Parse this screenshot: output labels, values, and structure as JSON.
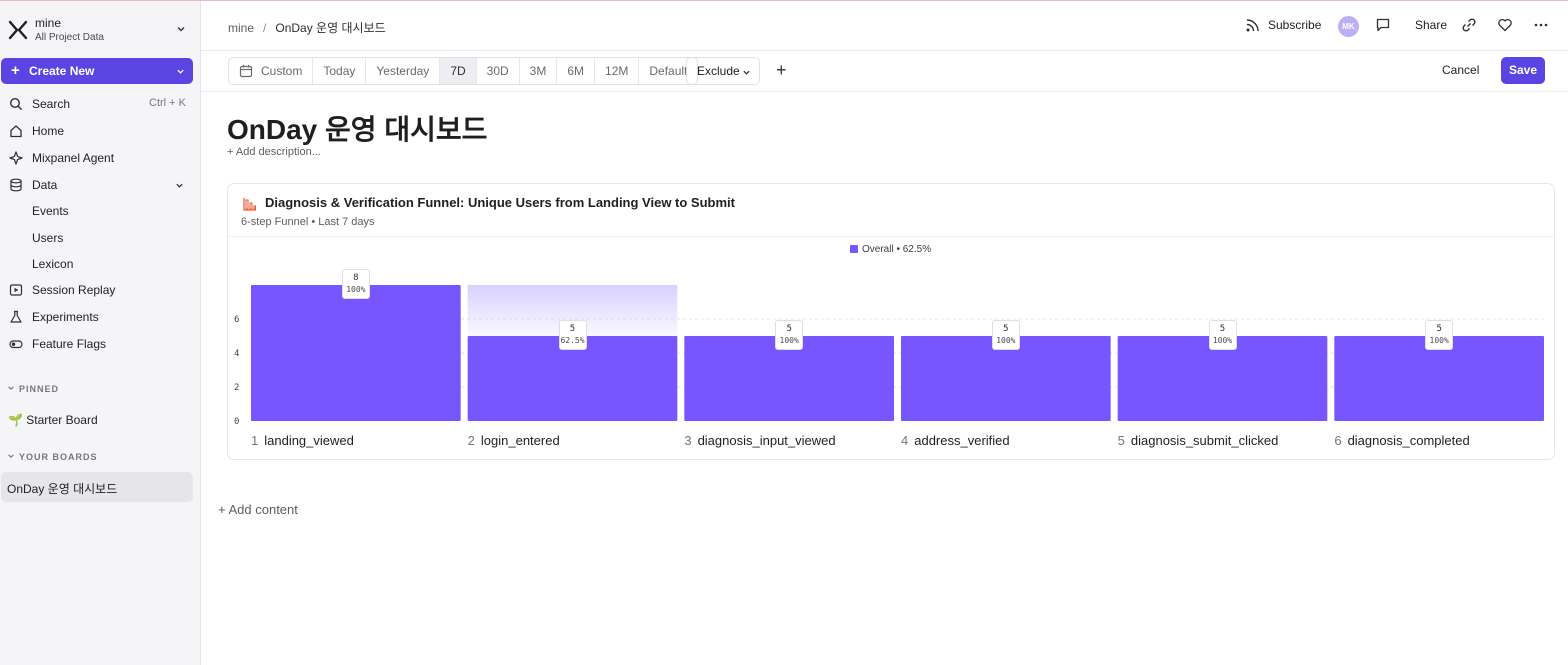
{
  "project": {
    "name": "mine",
    "subtitle": "All Project Data"
  },
  "sidebar": {
    "create_label": "Create New",
    "search": {
      "label": "Search",
      "shortcut": "Ctrl + K"
    },
    "items": [
      {
        "label": "Home",
        "icon": "home-icon"
      },
      {
        "label": "Mixpanel Agent",
        "icon": "sparkle-icon"
      },
      {
        "label": "Data",
        "icon": "database-icon"
      },
      {
        "label": "Events"
      },
      {
        "label": "Users"
      },
      {
        "label": "Lexicon"
      },
      {
        "label": "Session Replay",
        "icon": "play-icon"
      },
      {
        "label": "Experiments",
        "icon": "flask-icon"
      },
      {
        "label": "Feature Flags",
        "icon": "toggle-icon"
      }
    ],
    "pinned_heading": "PINNED",
    "pinned": [
      {
        "label": "🌱 Starter Board"
      }
    ],
    "boards_heading": "YOUR BOARDS",
    "boards": [
      {
        "label": "OnDay 운영 대시보드"
      }
    ]
  },
  "header": {
    "breadcrumb": [
      "mine",
      "OnDay 운영 대시보드"
    ],
    "subscribe": "Subscribe",
    "avatar": "MK",
    "share": "Share"
  },
  "toolbar": {
    "ranges": [
      "Custom",
      "Today",
      "Yesterday",
      "7D",
      "30D",
      "3M",
      "6M",
      "12M",
      "Default"
    ],
    "active_range": "7D",
    "exclude": "Exclude",
    "cancel": "Cancel",
    "save": "Save"
  },
  "board": {
    "title": "OnDay 운영 대시보드",
    "add_description": "+ Add description...",
    "add_content": "+ Add content"
  },
  "card": {
    "title": "Diagnosis & Verification Funnel: Unique Users from Landing View to Submit",
    "subtitle": "6-step Funnel • Last 7 days",
    "legend": "Overall • 62.5%"
  },
  "colors": {
    "accent": "#5a44e2",
    "bar": "#7856ff",
    "bar_faded": "#d8d1ff"
  },
  "chart_data": {
    "type": "bar",
    "categories": [
      "landing_viewed",
      "login_entered",
      "diagnosis_input_viewed",
      "address_verified",
      "diagnosis_submit_clicked",
      "diagnosis_completed"
    ],
    "step_numbers": [
      "1",
      "2",
      "3",
      "4",
      "5",
      "6"
    ],
    "series": [
      {
        "name": "Overall • 62.5%",
        "values": [
          8,
          5,
          5,
          5,
          5,
          5
        ],
        "conversion": [
          "100%",
          "62.5%",
          "100%",
          "100%",
          "100%",
          "100%"
        ]
      }
    ],
    "y_ticks": [
      "0",
      "2",
      "4",
      "6"
    ],
    "ylim": [
      0,
      8
    ],
    "legend": "top-center"
  }
}
